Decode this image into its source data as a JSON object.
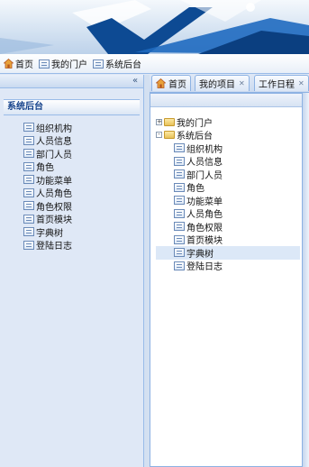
{
  "toolbar": {
    "items": [
      {
        "label": "首页"
      },
      {
        "label": "我的门户"
      },
      {
        "label": "系统后台"
      }
    ]
  },
  "left_panel": {
    "title": "系统后台",
    "items": [
      "组织机构",
      "人员信息",
      "部门人员",
      "角色",
      "功能菜单",
      "人员角色",
      "角色权限",
      "首页模块",
      "字典树",
      "登陆日志"
    ]
  },
  "tabs": [
    {
      "label": "首页"
    },
    {
      "label": "我的项目"
    },
    {
      "label": "工作日程"
    }
  ],
  "tree": {
    "nodes": [
      {
        "label": "我的门户",
        "expander": "+"
      },
      {
        "label": "系统后台",
        "expander": "-"
      }
    ],
    "children": [
      "组织机构",
      "人员信息",
      "部门人员",
      "角色",
      "功能菜单",
      "人员角色",
      "角色权限",
      "首页模块",
      "字典树",
      "登陆日志"
    ]
  },
  "colors": {
    "accent": "#15428b",
    "border": "#99bbe8",
    "banner_dark": "#0d4a93"
  }
}
